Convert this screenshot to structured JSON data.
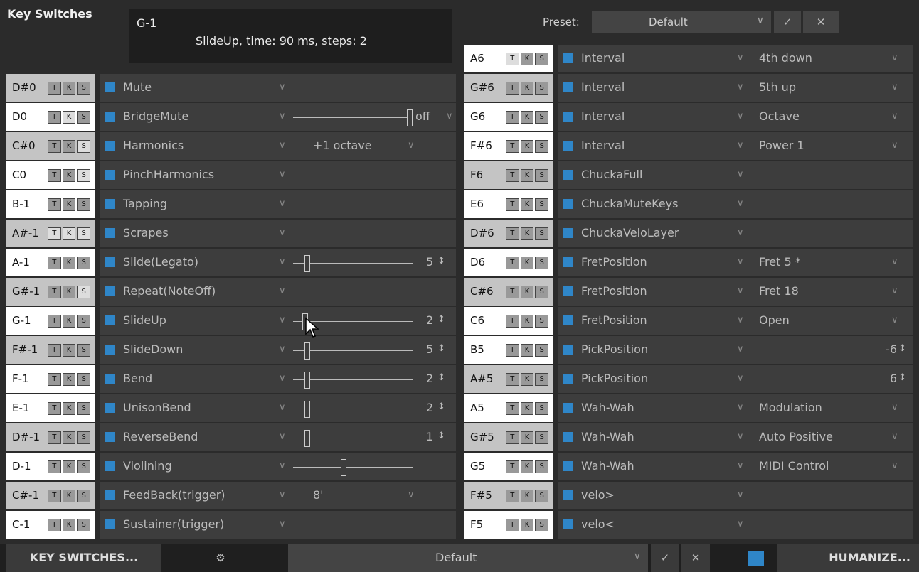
{
  "header": {
    "title": "Key Switches",
    "selected_key": "G-1",
    "description": "SlideUp, time: 90 ms, steps: 2",
    "preset_label": "Preset:",
    "preset_value": "Default",
    "confirm_icon": "check-icon",
    "cancel_icon": "close-icon"
  },
  "tks_labels": [
    "T",
    "K",
    "S"
  ],
  "left_rows": [
    {
      "key": "D#0",
      "shade": "gray",
      "active": [
        false,
        false,
        false
      ],
      "name": "Mute",
      "extra": "none"
    },
    {
      "key": "D0",
      "shade": "white",
      "active": [
        false,
        true,
        false
      ],
      "name": "BridgeMute",
      "extra": "slider-end",
      "label": "off"
    },
    {
      "key": "C#0",
      "shade": "gray",
      "active": [
        false,
        false,
        true
      ],
      "name": "Harmonics",
      "extra": "option",
      "option": "+1 octave"
    },
    {
      "key": "C0",
      "shade": "white",
      "active": [
        false,
        false,
        true
      ],
      "name": "PinchHarmonics",
      "extra": "none"
    },
    {
      "key": "B-1",
      "shade": "white",
      "active": [
        false,
        false,
        false
      ],
      "name": "Tapping",
      "extra": "none"
    },
    {
      "key": "A#-1",
      "shade": "gray",
      "active": [
        true,
        true,
        true
      ],
      "name": "Scrapes",
      "extra": "none"
    },
    {
      "key": "A-1",
      "shade": "white",
      "active": [
        false,
        false,
        false
      ],
      "name": "Slide(Legato)",
      "extra": "slider",
      "value": "5",
      "pos": 0.1
    },
    {
      "key": "G#-1",
      "shade": "gray",
      "active": [
        false,
        false,
        true
      ],
      "name": "Repeat(NoteOff)",
      "extra": "none"
    },
    {
      "key": "G-1",
      "shade": "white",
      "active": [
        false,
        false,
        false
      ],
      "name": "SlideUp",
      "extra": "slider",
      "value": "2",
      "pos": 0.08
    },
    {
      "key": "F#-1",
      "shade": "gray",
      "active": [
        false,
        false,
        false
      ],
      "name": "SlideDown",
      "extra": "slider",
      "value": "5",
      "pos": 0.1
    },
    {
      "key": "F-1",
      "shade": "white",
      "active": [
        false,
        false,
        false
      ],
      "name": "Bend",
      "extra": "slider",
      "value": "2",
      "pos": 0.1
    },
    {
      "key": "E-1",
      "shade": "white",
      "active": [
        false,
        false,
        false
      ],
      "name": "UnisonBend",
      "extra": "slider",
      "value": "2",
      "pos": 0.1
    },
    {
      "key": "D#-1",
      "shade": "gray",
      "active": [
        false,
        false,
        false
      ],
      "name": "ReverseBend",
      "extra": "slider",
      "value": "1",
      "pos": 0.1
    },
    {
      "key": "D-1",
      "shade": "white",
      "active": [
        false,
        false,
        false
      ],
      "name": "Violining",
      "extra": "slider-novalue",
      "pos": 0.42
    },
    {
      "key": "C#-1",
      "shade": "gray",
      "active": [
        false,
        false,
        false
      ],
      "name": "FeedBack(trigger)",
      "extra": "option",
      "option": "8'"
    },
    {
      "key": "C-1",
      "shade": "white",
      "active": [
        false,
        false,
        false
      ],
      "name": "Sustainer(trigger)",
      "extra": "none"
    }
  ],
  "right_rows": [
    {
      "key": "A6",
      "shade": "white",
      "active": [
        true,
        false,
        false
      ],
      "name": "Interval",
      "extra": "option",
      "option": "4th down"
    },
    {
      "key": "G#6",
      "shade": "gray",
      "active": [
        false,
        false,
        false
      ],
      "name": "Interval",
      "extra": "option",
      "option": "5th up"
    },
    {
      "key": "G6",
      "shade": "white",
      "active": [
        false,
        false,
        false
      ],
      "name": "Interval",
      "extra": "option",
      "option": "Octave"
    },
    {
      "key": "F#6",
      "shade": "white",
      "active": [
        false,
        false,
        false
      ],
      "name": "Interval",
      "extra": "option",
      "option": "Power 1"
    },
    {
      "key": "F6",
      "shade": "gray",
      "active": [
        false,
        false,
        false
      ],
      "name": "ChuckaFull",
      "extra": "none"
    },
    {
      "key": "E6",
      "shade": "white",
      "active": [
        false,
        false,
        false
      ],
      "name": "ChuckaMuteKeys",
      "extra": "none"
    },
    {
      "key": "D#6",
      "shade": "gray",
      "active": [
        false,
        false,
        false
      ],
      "name": "ChuckaVeloLayer",
      "extra": "none"
    },
    {
      "key": "D6",
      "shade": "white",
      "active": [
        false,
        false,
        false
      ],
      "name": "FretPosition",
      "extra": "option",
      "option": "Fret 5  *"
    },
    {
      "key": "C#6",
      "shade": "gray",
      "active": [
        false,
        false,
        false
      ],
      "name": "FretPosition",
      "extra": "option",
      "option": "Fret 18"
    },
    {
      "key": "C6",
      "shade": "white",
      "active": [
        false,
        false,
        false
      ],
      "name": "FretPosition",
      "extra": "option",
      "option": "Open"
    },
    {
      "key": "B5",
      "shade": "white",
      "active": [
        false,
        false,
        false
      ],
      "name": "PickPosition",
      "extra": "number",
      "value": "-6"
    },
    {
      "key": "A#5",
      "shade": "gray",
      "active": [
        false,
        false,
        false
      ],
      "name": "PickPosition",
      "extra": "number",
      "value": "6"
    },
    {
      "key": "A5",
      "shade": "white",
      "active": [
        false,
        false,
        false
      ],
      "name": "Wah-Wah",
      "extra": "option",
      "option": "Modulation"
    },
    {
      "key": "G#5",
      "shade": "gray",
      "active": [
        false,
        false,
        false
      ],
      "name": "Wah-Wah",
      "extra": "option",
      "option": "Auto Positive"
    },
    {
      "key": "G5",
      "shade": "white",
      "active": [
        false,
        false,
        false
      ],
      "name": "Wah-Wah",
      "extra": "option",
      "option": "MIDI Control"
    },
    {
      "key": "F#5",
      "shade": "gray",
      "active": [
        false,
        false,
        false
      ],
      "name": "velo>",
      "extra": "none"
    },
    {
      "key": "F5",
      "shade": "white",
      "active": [
        false,
        false,
        false
      ],
      "name": "velo<",
      "extra": "none"
    }
  ],
  "footer": {
    "key_switches_button": "KEY SWITCHES...",
    "settings_icon": "gear-icon",
    "preset_value": "Default",
    "humanize_button": "HUMANIZE..."
  },
  "colors": {
    "accent": "#2f86c8",
    "background": "#2b2b2b",
    "row": "#3d3d3d"
  }
}
